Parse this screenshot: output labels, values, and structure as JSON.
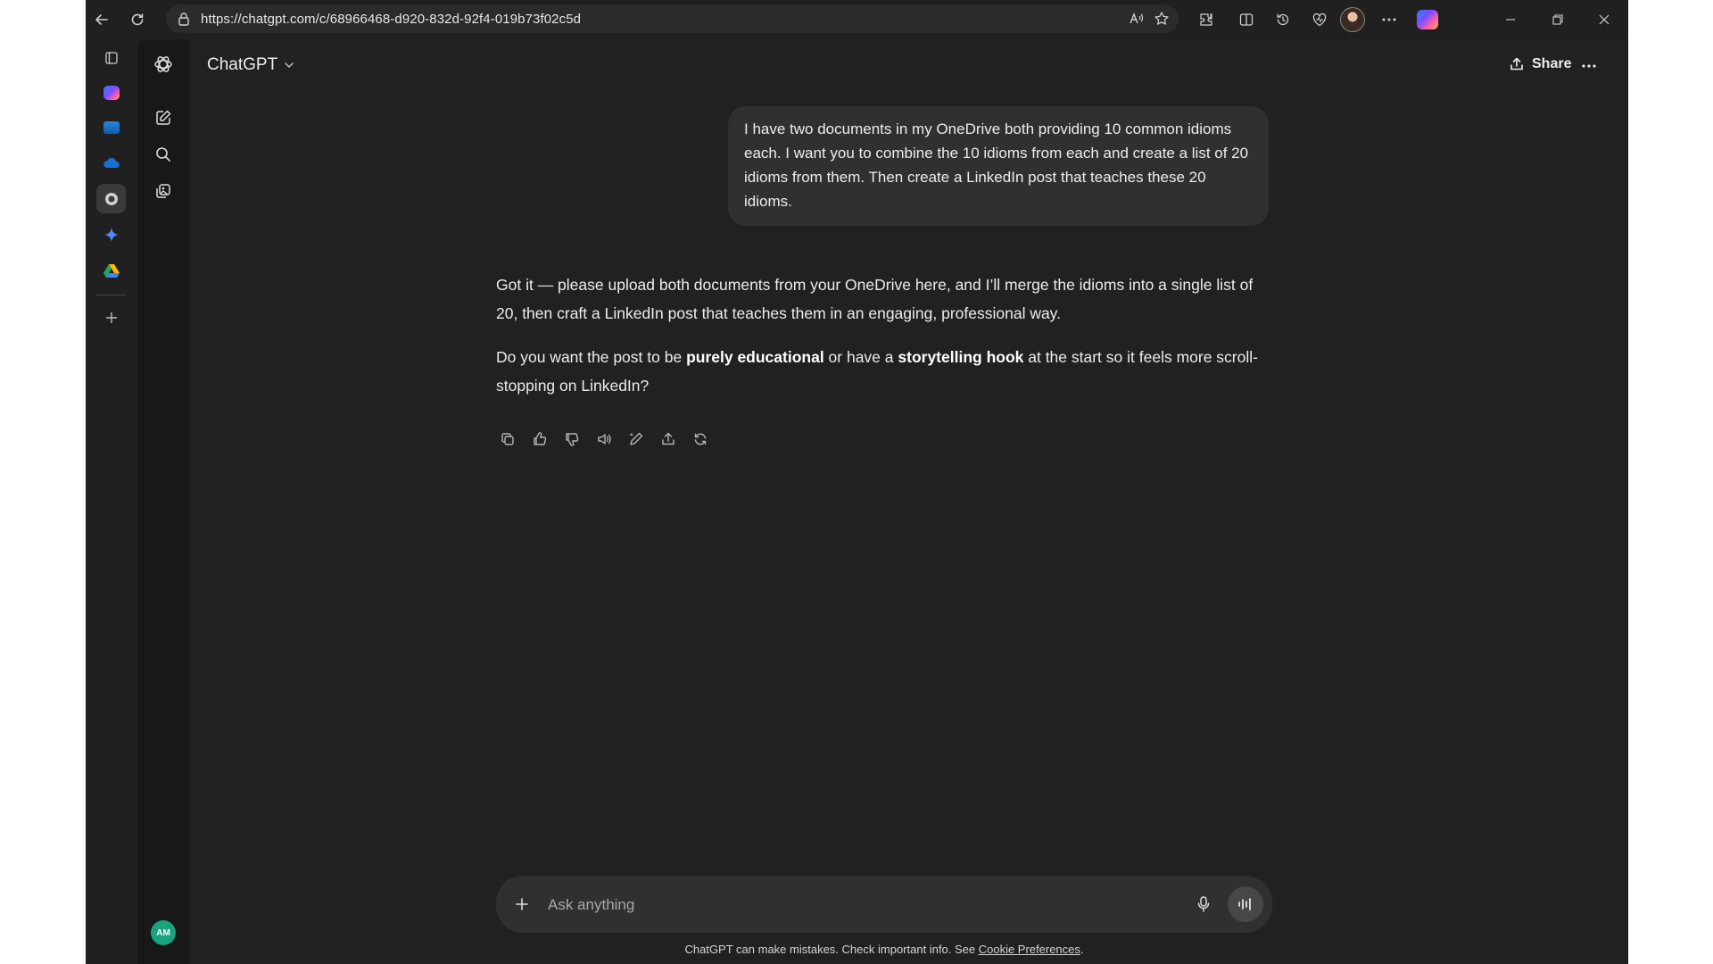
{
  "browser": {
    "url": "https://chatgpt.com/c/68966468-d920-832d-92f4-019b73f02c5d",
    "read_aloud_icon": "read-aloud-icon"
  },
  "edge_sidebar": {
    "items": [
      {
        "name": "copilot-app-icon",
        "color": "#7c4dff"
      },
      {
        "name": "outlook-app-icon",
        "color": "#2b88d8"
      },
      {
        "name": "onedrive-app-icon",
        "color": "#1b6fd1"
      },
      {
        "name": "chatgpt-app-icon",
        "color": "#cfcfcf"
      },
      {
        "name": "gemini-app-icon",
        "color": "#4e8cff"
      },
      {
        "name": "google-drive-app-icon",
        "color": "#1fa463"
      }
    ]
  },
  "app": {
    "model_name": "ChatGPT",
    "share_label": "Share",
    "user_initials": "AM"
  },
  "conversation": {
    "user_message": "I have two documents in my OneDrive both providing 10 common idioms each. I want you to combine the 10 idioms from each and create a list of 20 idioms from them. Then create a LinkedIn post that teaches these 20 idioms.",
    "assistant": {
      "p1": "Got it — please upload both documents from your OneDrive here, and I’ll merge the idioms into a single list of 20, then craft a LinkedIn post that teaches them in an engaging, professional way.",
      "p2_a": "Do you want the post to be ",
      "p2_b": "purely educational",
      "p2_c": " or have a ",
      "p2_d": "storytelling hook",
      "p2_e": " at the start so it feels more scroll-stopping on LinkedIn?"
    }
  },
  "composer": {
    "placeholder": "Ask anything"
  },
  "footer": {
    "disclaimer_text": "ChatGPT can make mistakes. Check important info. See ",
    "cookie_link": "Cookie Preferences",
    "end": "."
  }
}
